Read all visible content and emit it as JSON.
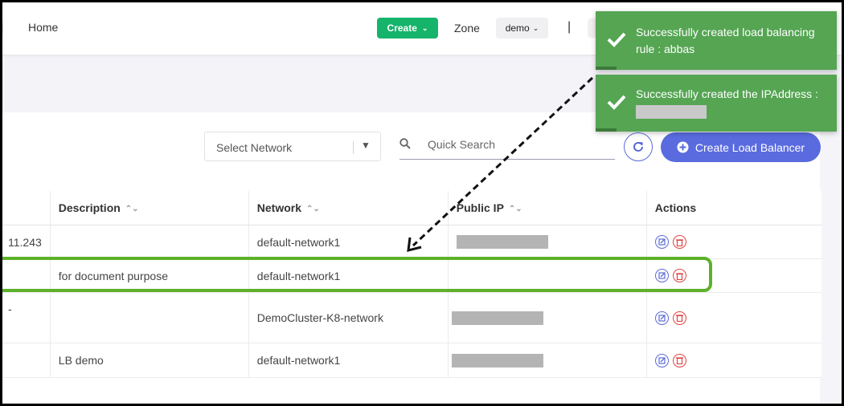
{
  "topbar": {
    "home_label": "Home",
    "create_label": "Create",
    "zone_label": "Zone",
    "zone_value": "demo",
    "separator": "|"
  },
  "toolbar": {
    "network_placeholder": "Select Network",
    "search_placeholder": "Quick Search",
    "create_lb_label": "Create Load Balancer"
  },
  "table": {
    "columns": [
      "Description",
      "Network",
      "Public IP",
      "Actions"
    ],
    "rows": [
      {
        "name_fragment": "11.243",
        "description": "",
        "network": "default-network1",
        "public_ip_redacted": true
      },
      {
        "name_fragment": "",
        "description": "for document purpose",
        "network": "default-network1",
        "public_ip_redacted": false
      },
      {
        "name_fragment": "-",
        "description": "",
        "network": "DemoCluster-K8-network",
        "public_ip_redacted": true
      },
      {
        "name_fragment": "",
        "description": "LB demo",
        "network": "default-network1",
        "public_ip_redacted": true
      }
    ]
  },
  "toasts": [
    {
      "message": "Successfully created load balancing rule : abbas"
    },
    {
      "message": "Successfully created the IPAddress :"
    }
  ],
  "colors": {
    "create_green": "#16b36b",
    "toast_green": "#55a553",
    "primary_blue": "#5a6bdf",
    "highlight_green": "#5db12a",
    "delete_red": "#dd4444"
  }
}
